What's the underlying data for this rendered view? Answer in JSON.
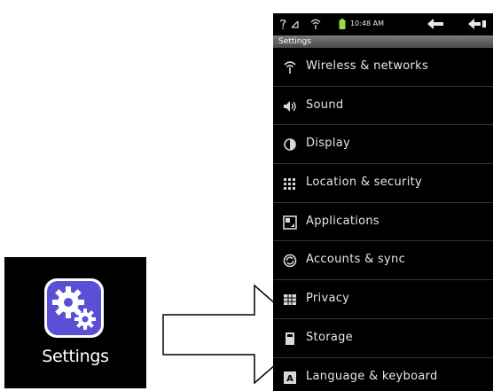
{
  "launcher": {
    "app_label": "Settings",
    "app_icon": "settings-gears-icon",
    "icon_color": "#5b4fd6"
  },
  "arrow": {
    "icon": "right-arrow-icon"
  },
  "phone": {
    "status_bar": {
      "left_icons": [
        "usb-debug-icon",
        "signal-icon",
        "wifi-icon",
        "battery-icon"
      ],
      "time": "10:48 AM",
      "nav_icons": [
        "back-icon",
        "back-menu-icon"
      ]
    },
    "title": "Settings",
    "menu": [
      {
        "label": "Wireless & networks",
        "icon": "wifi-icon"
      },
      {
        "label": "Sound",
        "icon": "speaker-icon"
      },
      {
        "label": "Display",
        "icon": "brightness-icon"
      },
      {
        "label": "Location & security",
        "icon": "grid-lock-icon"
      },
      {
        "label": "Applications",
        "icon": "applications-icon"
      },
      {
        "label": "Accounts & sync",
        "icon": "sync-icon"
      },
      {
        "label": "Privacy",
        "icon": "privacy-icon"
      },
      {
        "label": "Storage",
        "icon": "storage-icon"
      },
      {
        "label": "Language & keyboard",
        "icon": "keyboard-icon"
      }
    ]
  }
}
